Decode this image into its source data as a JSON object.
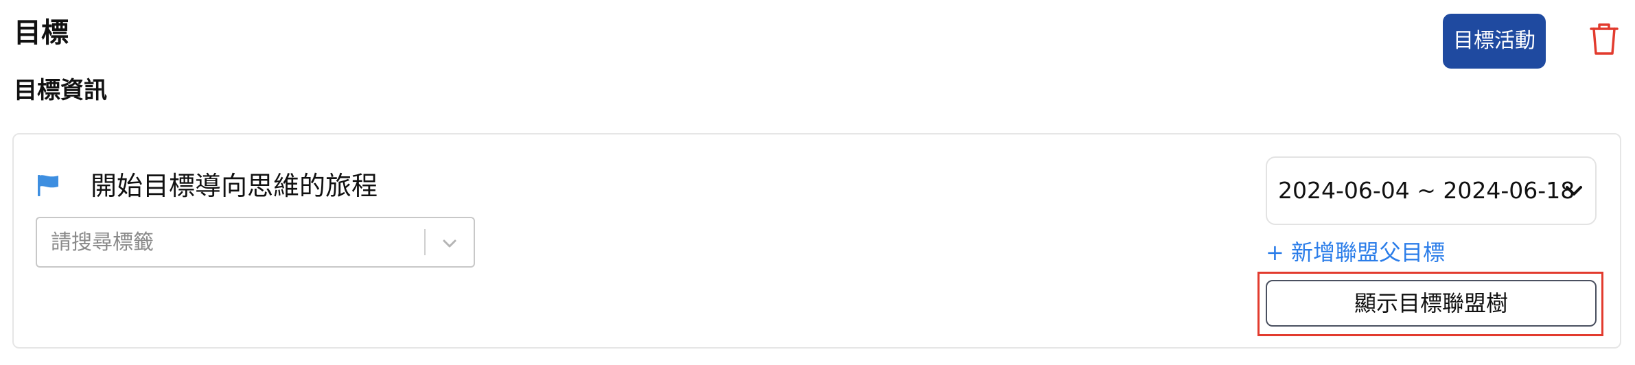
{
  "header": {
    "title": "目標",
    "goal_activity_label": "目標活動",
    "delete_icon": "trash-icon"
  },
  "section": {
    "title": "目標資訊"
  },
  "goal": {
    "flag_icon": "flag-icon",
    "title": "開始目標導向思維的旅程",
    "tag_search": {
      "placeholder": "請搜尋標籤",
      "value": ""
    },
    "date_range": "2024-06-04 ~ 2024-06-18",
    "add_parent_label": "+ 新增聯盟父目標",
    "show_tree_label": "顯示目標聯盟樹"
  },
  "colors": {
    "primary": "#1f4aa0",
    "link": "#2b7de9",
    "danger": "#e23b2e",
    "flag": "#3d8ee0"
  }
}
